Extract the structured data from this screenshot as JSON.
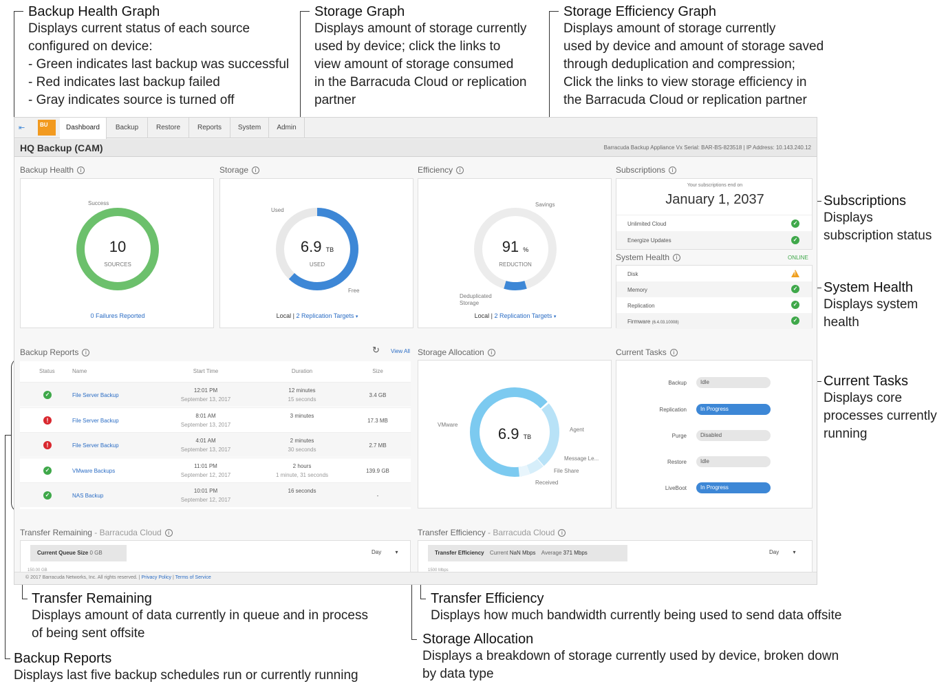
{
  "callouts": {
    "backup_health_graph": {
      "title": "Backup Health Graph",
      "body": "Displays current status of each source\nconfigured on device:\n- Green indicates last backup was successful\n- Red indicates last backup failed\n- Gray indicates source is turned off"
    },
    "storage_graph": {
      "title": "Storage Graph",
      "body": "Displays amount of storage currently\nused by device; click the links to\nview amount of storage consumed\nin the Barracuda Cloud or replication\npartner"
    },
    "storage_efficiency_graph": {
      "title": "Storage Efficiency Graph",
      "body": "Displays amount of storage currently\nused by device and amount of storage saved\nthrough deduplication and compression;\nClick the links to view storage efficiency in\nthe Barracuda Cloud or replication partner"
    },
    "subscriptions": {
      "title": "Subscriptions",
      "body": "Displays\nsubscription status"
    },
    "system_health": {
      "title": "System Health",
      "body": "Displays system\nhealth"
    },
    "current_tasks": {
      "title": "Current Tasks",
      "body": "Displays core\nprocesses currently\nrunning"
    },
    "transfer_remaining": {
      "title": "Transfer Remaining",
      "body": "Displays amount of data currently in queue and in process\nof being sent offsite"
    },
    "transfer_efficiency": {
      "title": "Transfer Efficiency",
      "body": "Displays how much bandwidth currently being used to send data offsite"
    },
    "storage_allocation": {
      "title": "Storage Allocation",
      "body": "Displays a breakdown of storage currently used by device, broken down\nby data type"
    },
    "backup_reports": {
      "title": "Backup Reports",
      "body": "Displays last  five backup schedules run or currently running"
    }
  },
  "nav": {
    "logo": "BU",
    "tabs": [
      "Dashboard",
      "Backup",
      "Restore",
      "Reports",
      "System",
      "Admin"
    ]
  },
  "header": {
    "title": "HQ Backup (CAM)",
    "appliance": "Barracuda Backup Appliance Vx",
    "serial_label": "Serial:",
    "serial": "BAR-BS-823518",
    "ip_label": "IP Address:",
    "ip": "10.143.240.12"
  },
  "backup_health": {
    "title": "Backup Health",
    "success_label": "Success",
    "count": "10",
    "count_label": "SOURCES",
    "failures_link": "0 Failures Reported",
    "ring_color": "#6cc06c"
  },
  "storage": {
    "title": "Storage",
    "used_label": "Used",
    "free_label": "Free",
    "value": "6.9",
    "unit": "TB",
    "sub_label": "USED",
    "used_fraction": 0.62,
    "local_link": "Local",
    "replication_link": "2 Replication Targets",
    "ring_color": "#3d87d6"
  },
  "efficiency": {
    "title": "Efficiency",
    "savings_label": "Savings",
    "dedup_label": "Deduplicated\nStorage",
    "value": "91",
    "unit": "%",
    "sub_label": "REDUCTION",
    "reduction_fraction": 0.91,
    "local_link": "Local",
    "replication_link": "2 Replication Targets",
    "ring_color": "#3d87d6"
  },
  "subscriptions": {
    "title": "Subscriptions",
    "ends_label": "Your subscriptions end on",
    "end_date": "January 1, 2037",
    "items": [
      {
        "label": "Unlimited Cloud",
        "status": "ok"
      },
      {
        "label": "Energize Updates",
        "status": "ok"
      }
    ]
  },
  "system_health": {
    "title": "System Health",
    "state": "ONLINE",
    "items": [
      {
        "label": "Disk",
        "status": "warn",
        "extra": ""
      },
      {
        "label": "Memory",
        "status": "ok",
        "extra": ""
      },
      {
        "label": "Replication",
        "status": "ok",
        "extra": ""
      },
      {
        "label": "Firmware",
        "status": "ok",
        "extra": "(6.4.03.10008)"
      }
    ]
  },
  "backup_reports": {
    "title": "Backup Reports",
    "view_all": "View All",
    "columns": [
      "Status",
      "Name",
      "Start Time",
      "Duration",
      "Size"
    ],
    "rows": [
      {
        "status": "ok",
        "name": "File Server Backup",
        "time": "12:01 PM",
        "date": "September 13, 2017",
        "duration": "12 minutes",
        "duration2": "15 seconds",
        "size": "3.4 GB"
      },
      {
        "status": "err",
        "name": "File Server Backup",
        "time": "8:01 AM",
        "date": "September 13, 2017",
        "duration": "3 minutes",
        "duration2": "",
        "size": "17.3 MB"
      },
      {
        "status": "err",
        "name": "File Server Backup",
        "time": "4:01 AM",
        "date": "September 13, 2017",
        "duration": "2 minutes",
        "duration2": "30 seconds",
        "size": "2.7 MB"
      },
      {
        "status": "ok",
        "name": "VMware Backups",
        "time": "11:01 PM",
        "date": "September 12, 2017",
        "duration": "2 hours",
        "duration2": "1 minute, 31 seconds",
        "size": "139.9 GB"
      },
      {
        "status": "ok",
        "name": "NAS Backup",
        "time": "10:01 PM",
        "date": "September 12, 2017",
        "duration": "16 seconds",
        "duration2": "",
        "size": "-"
      }
    ]
  },
  "storage_allocation": {
    "title": "Storage Allocation",
    "value": "6.9",
    "unit": "TB",
    "labels": {
      "vmware": "VMware",
      "agent": "Agent",
      "message": "Message Le...",
      "fileshare": "File Share",
      "received": "Received"
    }
  },
  "current_tasks": {
    "title": "Current Tasks",
    "items": [
      {
        "label": "Backup",
        "state": "Idle",
        "active": false
      },
      {
        "label": "Replication",
        "state": "In Progress",
        "active": true
      },
      {
        "label": "Purge",
        "state": "Disabled",
        "active": false
      },
      {
        "label": "Restore",
        "state": "Idle",
        "active": false
      },
      {
        "label": "LiveBoot",
        "state": "In Progress",
        "active": true
      }
    ]
  },
  "transfer_remaining": {
    "title": "Transfer Remaining",
    "subtitle": "- Barracuda Cloud",
    "queue_label": "Current Queue Size",
    "queue_value": "0 GB",
    "range": "Day",
    "axis_top": "150.00 GB"
  },
  "transfer_efficiency": {
    "title": "Transfer Efficiency",
    "subtitle": "- Barracuda Cloud",
    "eff_label": "Transfer Efficiency",
    "current_label": "Current",
    "current_value": "NaN Mbps",
    "average_label": "Average",
    "average_value": "371 Mbps",
    "range": "Day",
    "axis_top": "1500 Mbps"
  },
  "footer": {
    "copyright": "© 2017 Barracuda Networks, Inc. All rights reserved.",
    "privacy": "Privacy Policy",
    "terms": "Terms of Service"
  }
}
